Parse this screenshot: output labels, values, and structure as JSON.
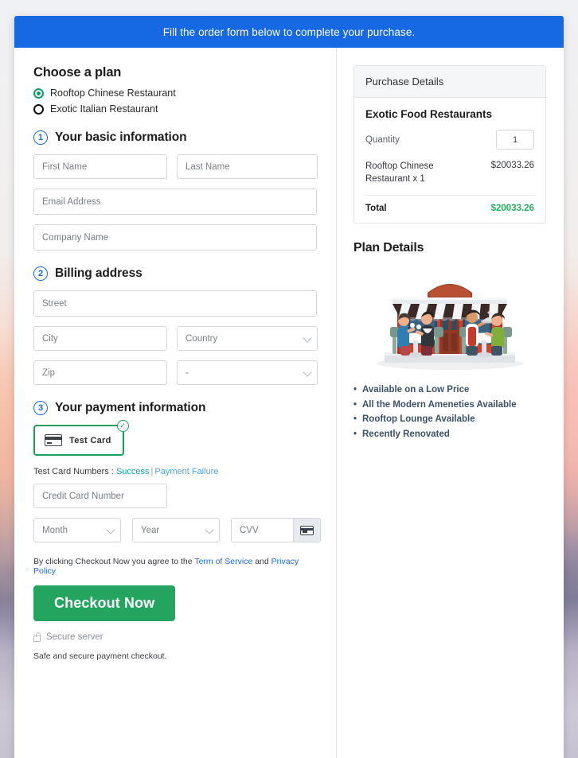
{
  "banner": {
    "message": "Fill the order form below to complete your purchase."
  },
  "plan_chooser": {
    "title": "Choose a plan",
    "options": [
      {
        "label": "Rooftop Chinese Restaurant",
        "selected": true
      },
      {
        "label": "Exotic Italian Restaurant",
        "selected": false
      }
    ]
  },
  "step1": {
    "number": "1",
    "title": "Your basic information",
    "fields": {
      "first_name_placeholder": "First Name",
      "last_name_placeholder": "Last Name",
      "email_placeholder": "Email Address",
      "company_placeholder": "Company Name"
    }
  },
  "step2": {
    "number": "2",
    "title": "Billing address",
    "fields": {
      "street_placeholder": "Street",
      "city_placeholder": "City",
      "country_value": "Country",
      "zip_placeholder": "Zip",
      "state_value": "-"
    }
  },
  "step3": {
    "number": "3",
    "title": "Your payment information",
    "test_card_label": "Test  Card",
    "test_numbers_prefix": "Test Card Numbers :",
    "test_numbers_success": "Success",
    "test_numbers_separator": "|",
    "test_numbers_failure": "Payment Failure",
    "card_number_placeholder": "Credit Card Number",
    "month_value": "Month",
    "year_value": "Year",
    "cvv_placeholder": "CVV"
  },
  "footer": {
    "terms_prefix": "By clicking Checkout Now you agree to the",
    "terms_link": "Term of Service",
    "terms_middle": "and",
    "privacy_link": "Privacy Policy",
    "checkout_label": "Checkout Now",
    "secure_server_label": "Secure server",
    "safe_note": "Safe and secure payment checkout."
  },
  "purchase_details": {
    "heading": "Purchase Details",
    "product_name": "Exotic Food Restaurants",
    "quantity_label": "Quantity",
    "quantity_value": "1",
    "line_item_name": "Rooftop Chinese Restaurant x 1",
    "line_item_price": "$20033.26",
    "total_label": "Total",
    "total_value": "$20033.26"
  },
  "plan_details": {
    "title": "Plan Details",
    "features": [
      "Available on a Low Price",
      "All the Modern Ameneties Available",
      "Rooftop Lounge Available",
      "Recently Renovated"
    ]
  },
  "colors": {
    "banner_blue": "#1668e3",
    "accent_green": "#24a55f",
    "total_green": "#23b05e",
    "step_blue": "#1b6ee0",
    "link_blue": "#1b6ee0",
    "success_teal": "#13a8a0",
    "failure_blue": "#4aa7e8",
    "feature_text": "#3d5166"
  }
}
